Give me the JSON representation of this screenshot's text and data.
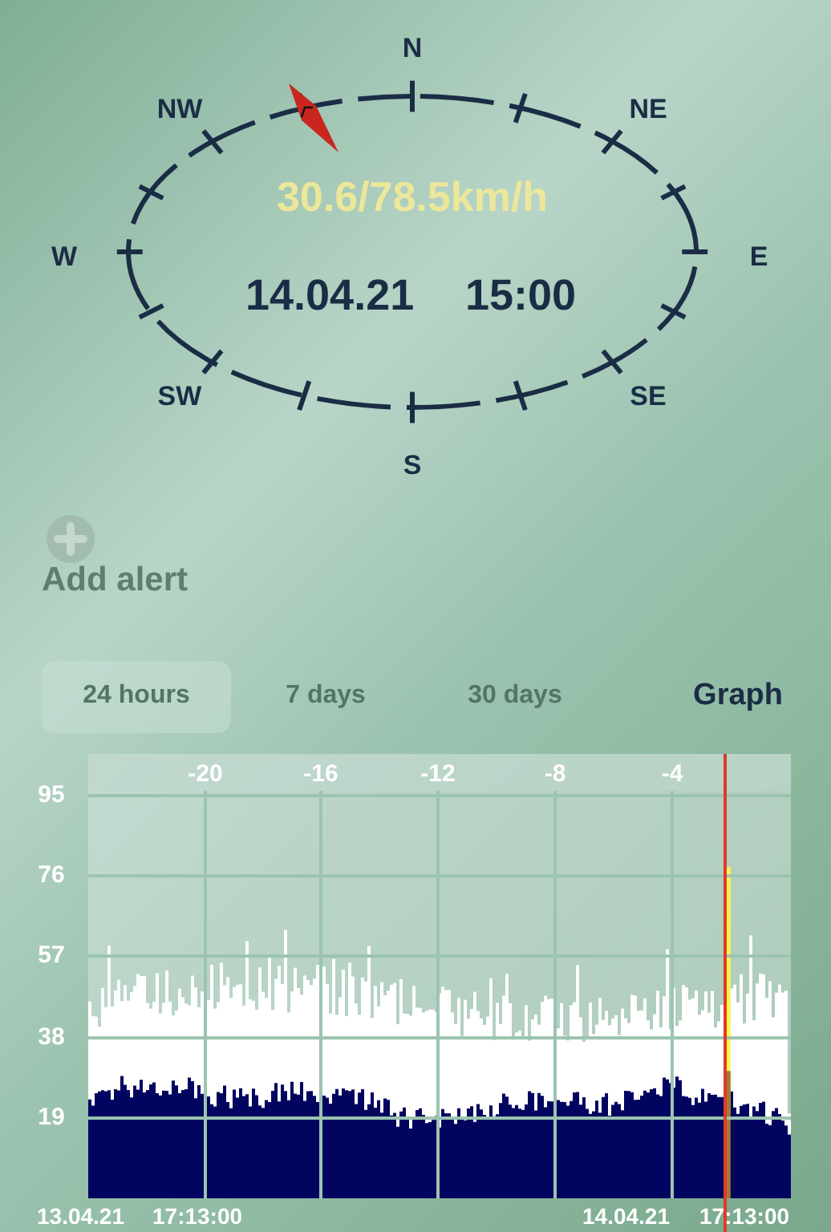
{
  "compass": {
    "directions": [
      {
        "label": "N"
      },
      {
        "label": "NE"
      },
      {
        "label": "E"
      },
      {
        "label": "SE"
      },
      {
        "label": "S"
      },
      {
        "label": "SW"
      },
      {
        "label": "W"
      },
      {
        "label": "NW"
      }
    ],
    "speed": "30.6/78.5km/h",
    "date": "14.04.21",
    "time": "15:00"
  },
  "alert": {
    "label": "Add alert"
  },
  "tabs": [
    {
      "label": "24 hours",
      "selected": true
    },
    {
      "label": "7 days",
      "selected": false
    },
    {
      "label": "30 days",
      "selected": false
    }
  ],
  "graph_button": {
    "label": "Graph"
  },
  "chart": {
    "x_labels": [
      "-20",
      "-16",
      "-12",
      "-8",
      "-4"
    ],
    "y_labels": [
      "95",
      "76",
      "57",
      "38",
      "19"
    ],
    "bottom_labels": [
      "13.04.21",
      "17:13:00",
      "14.04.21",
      "17:13:00"
    ]
  }
}
